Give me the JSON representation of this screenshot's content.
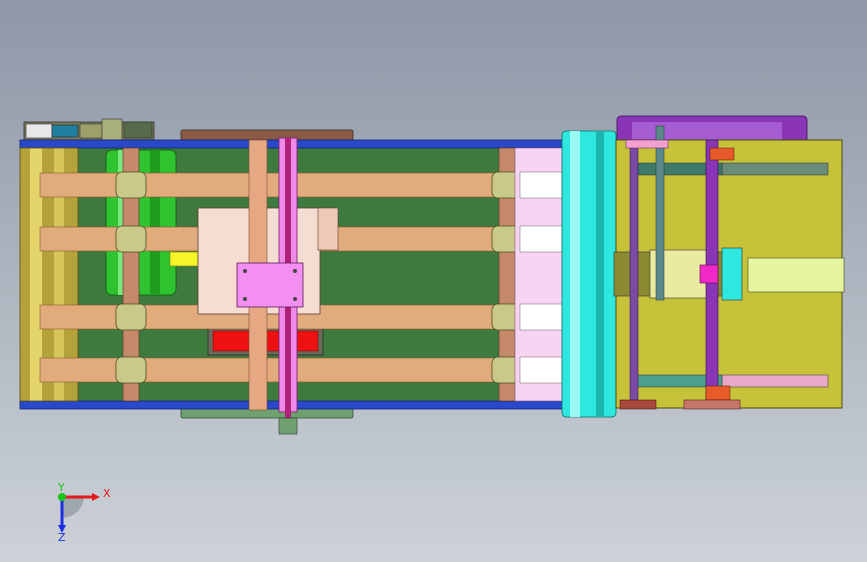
{
  "viewport": {
    "background_top": "#8d97a6",
    "background_bottom": "#cdd2d8"
  },
  "triad": {
    "x_label": "X",
    "y_label": "Y",
    "z_label": "Z",
    "x_color": "#e11b1b",
    "y_color": "#19c419",
    "z_color": "#1b2fe0"
  },
  "model": {
    "part_colors": {
      "frame_plate": "#3e7a3e",
      "belt": "#e2ab7c",
      "rail_blue": "#2a49c9",
      "motor_green": "#2fc42f",
      "roller_gold": "#c9b84a",
      "pink_carriage": "#f28ff0",
      "cyan_roller": "#2ee8e0",
      "yellow_housing": "#c6c23a",
      "purple_gantry": "#8a35b5",
      "red_block": "#ee1111"
    }
  }
}
